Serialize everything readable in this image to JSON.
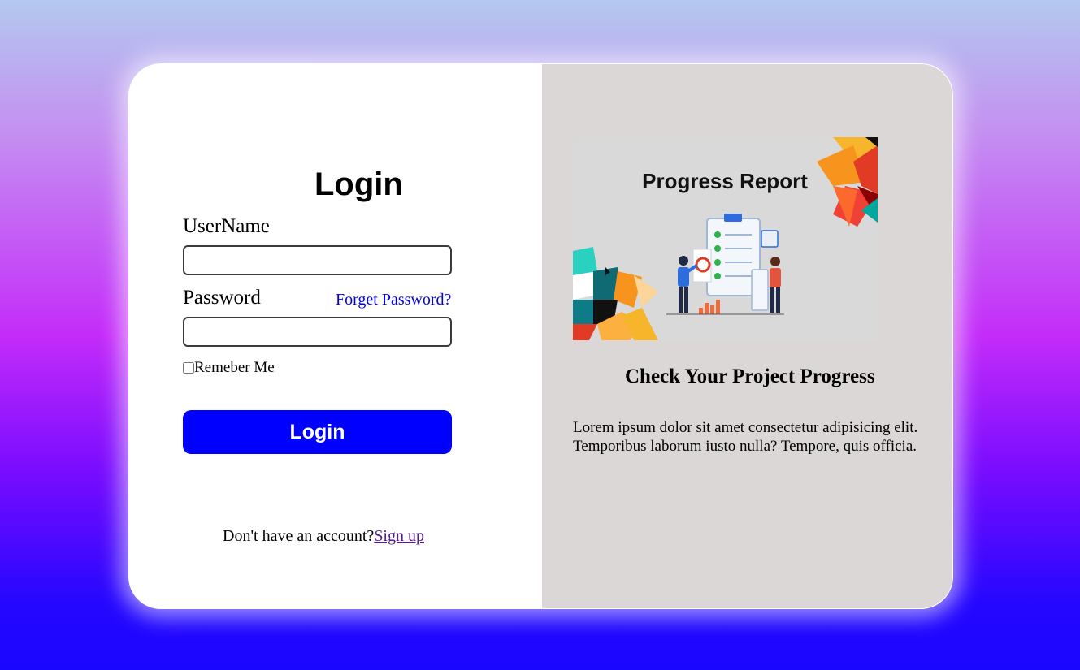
{
  "login": {
    "title": "Login",
    "username_label": "UserName",
    "username_value": "",
    "password_label": "Password",
    "password_value": "",
    "forgot_password": "Forget Password?",
    "remember_me": "Remeber Me",
    "remember_checked": false,
    "submit_label": "Login",
    "signup_prompt": "Don't have an account?",
    "signup_link": "Sign up"
  },
  "promo": {
    "image_text": "Progress Report",
    "heading": "Check Your Project Progress",
    "body": "Lorem ipsum dolor sit amet consectetur adipisicing elit. Temporibus laborum iusto nulla? Tempore, quis officia."
  },
  "colors": {
    "accent": "#0000ff",
    "link": "#0000ee",
    "visited_link": "#551a8b",
    "right_panel": "#dbd7d7"
  }
}
